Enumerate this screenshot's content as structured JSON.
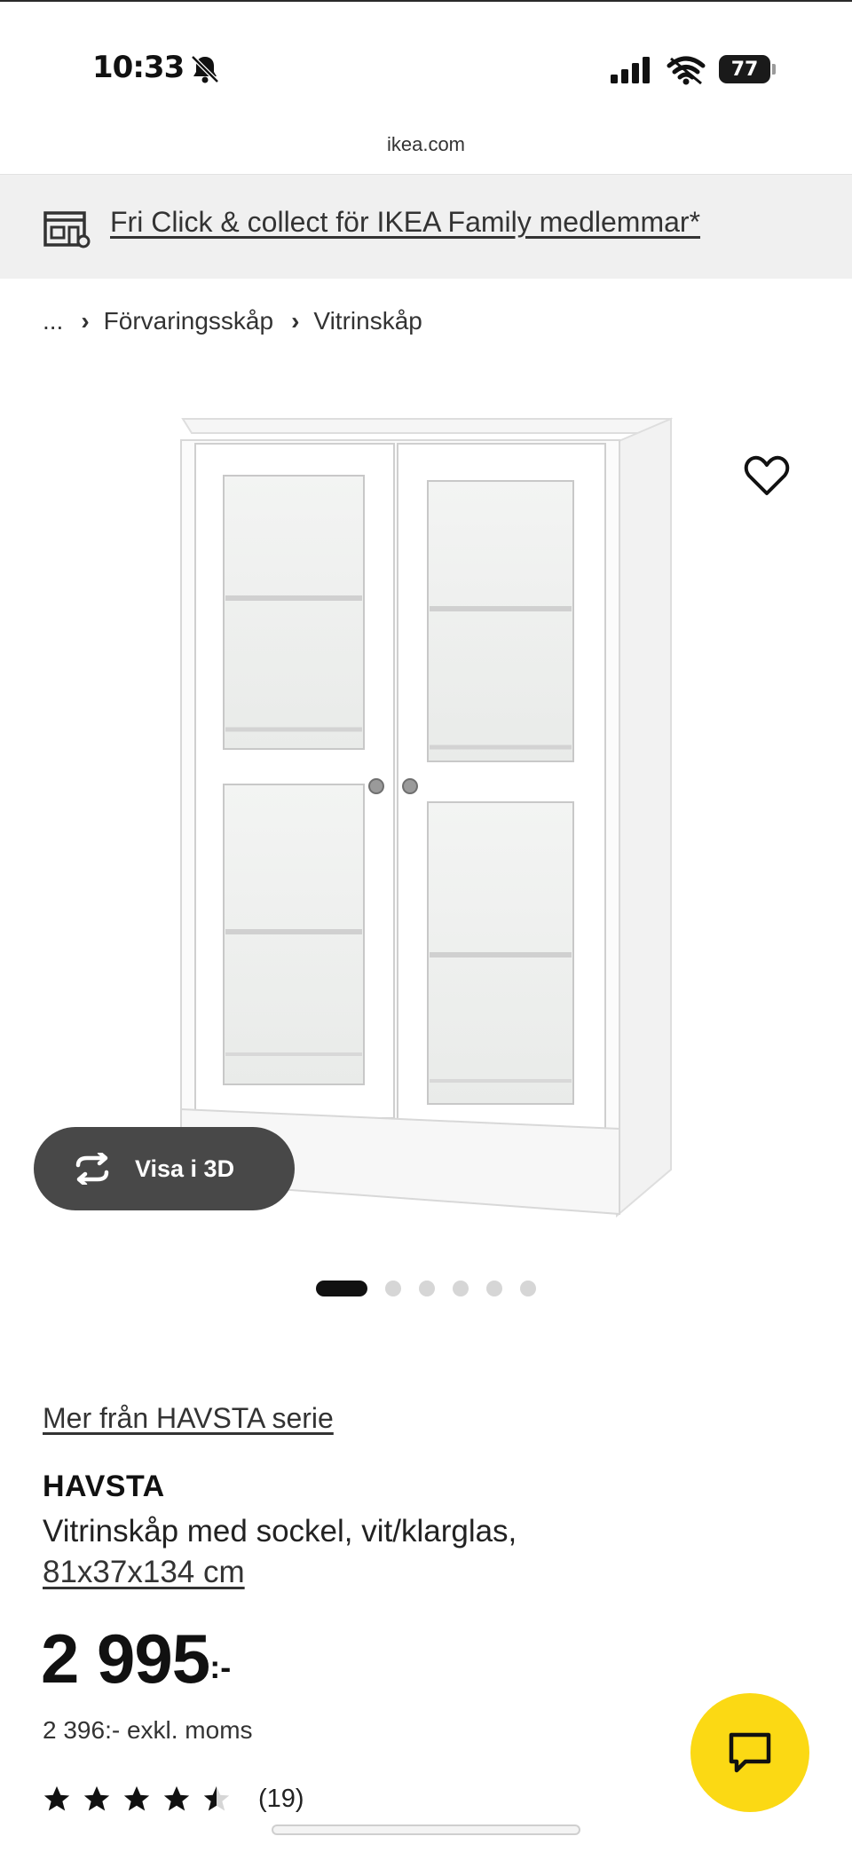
{
  "status_bar": {
    "time": "10:33",
    "battery": "77",
    "icons": [
      "bell-slash-icon",
      "cellular-signal-icon",
      "wifi-icon",
      "battery-icon"
    ]
  },
  "browser": {
    "url": "ikea.com"
  },
  "banner": {
    "text": "Fri Click & collect för IKEA Family medlemmar*",
    "icon": "store-icon"
  },
  "breadcrumb": {
    "ellipsis": "...",
    "items": [
      "Förvaringsskåp",
      "Vitrinskåp"
    ]
  },
  "gallery": {
    "view_3d_label": "Visa i 3D",
    "image_count": 6,
    "active_index": 0
  },
  "product": {
    "series_link": "Mer från HAVSTA serie",
    "name": "HAVSTA",
    "description": "Vitrinskåp med sockel, vit/klarglas,",
    "dimensions": "81x37x134 cm",
    "price": "2 995",
    "price_suffix": ":-",
    "price_ex_vat": "2 396:- exkl. moms",
    "rating": 4.5,
    "rating_count": "(19)"
  },
  "colors": {
    "chat_button": "#fbd914",
    "view_3d_button": "#484848",
    "banner_bg": "#f0f0f0"
  }
}
